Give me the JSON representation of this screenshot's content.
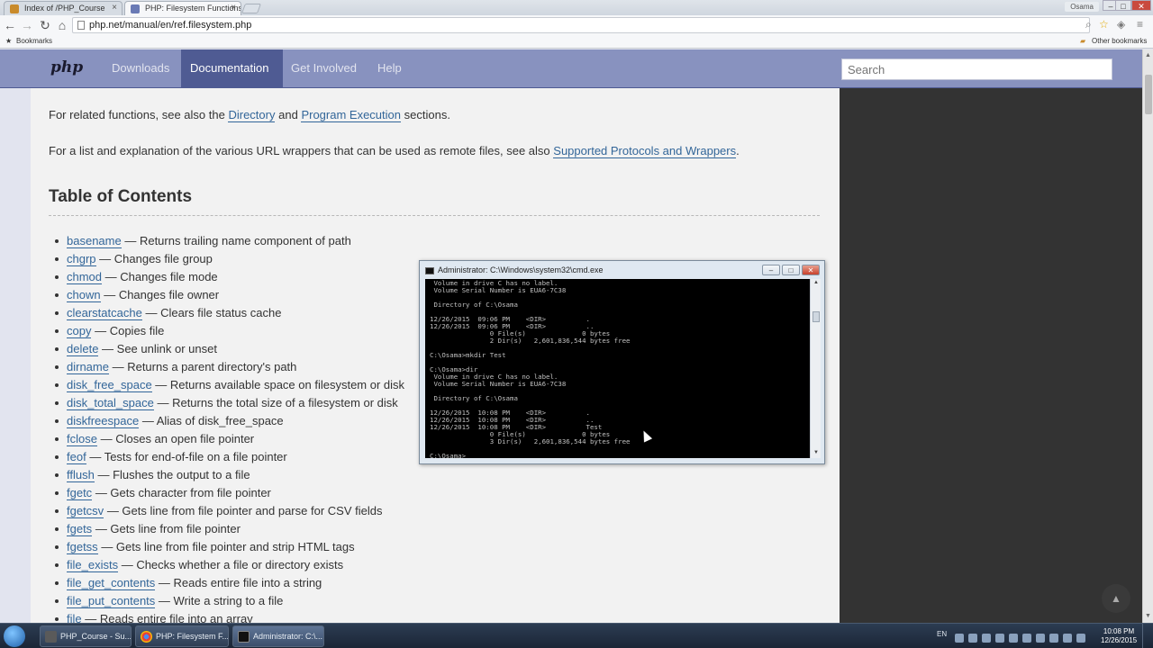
{
  "browser": {
    "tabs": [
      {
        "label": "Index of /PHP_Course",
        "active": false
      },
      {
        "label": "PHP: Filesystem Functions",
        "active": true
      }
    ],
    "user": "Osama",
    "url": "php.net/manual/en/ref.filesystem.php",
    "bookmarks_label": "Bookmarks",
    "other_bookmarks_label": "Other bookmarks"
  },
  "phpnav": {
    "logo": "php",
    "links": [
      "Downloads",
      "Documentation",
      "Get Involved",
      "Help"
    ],
    "active_link": "Documentation",
    "search_placeholder": "Search"
  },
  "content": {
    "related_prefix": "For related functions, see also the",
    "related_link1": "Directory",
    "related_and": "and",
    "related_link2": "Program Execution",
    "related_suffix": "sections.",
    "wrappers_prefix": "For a list and explanation of the various URL wrappers that can be used as remote files, see also",
    "wrappers_link": "Supported Protocols and Wrappers",
    "wrappers_suffix": ".",
    "toc_title": "Table of Contents",
    "toc": [
      {
        "fn": "basename",
        "desc": "— Returns trailing name component of path"
      },
      {
        "fn": "chgrp",
        "desc": "— Changes file group"
      },
      {
        "fn": "chmod",
        "desc": "— Changes file mode"
      },
      {
        "fn": "chown",
        "desc": "— Changes file owner"
      },
      {
        "fn": "clearstatcache",
        "desc": "— Clears file status cache"
      },
      {
        "fn": "copy",
        "desc": "— Copies file"
      },
      {
        "fn": "delete",
        "desc": "— See unlink or unset"
      },
      {
        "fn": "dirname",
        "desc": "— Returns a parent directory's path"
      },
      {
        "fn": "disk_free_space",
        "desc": "— Returns available space on filesystem or disk"
      },
      {
        "fn": "disk_total_space",
        "desc": "— Returns the total size of a filesystem or disk"
      },
      {
        "fn": "diskfreespace",
        "desc": "— Alias of disk_free_space"
      },
      {
        "fn": "fclose",
        "desc": "— Closes an open file pointer"
      },
      {
        "fn": "feof",
        "desc": "— Tests for end-of-file on a file pointer"
      },
      {
        "fn": "fflush",
        "desc": "— Flushes the output to a file"
      },
      {
        "fn": "fgetc",
        "desc": "— Gets character from file pointer"
      },
      {
        "fn": "fgetcsv",
        "desc": "— Gets line from file pointer and parse for CSV fields"
      },
      {
        "fn": "fgets",
        "desc": "— Gets line from file pointer"
      },
      {
        "fn": "fgetss",
        "desc": "— Gets line from file pointer and strip HTML tags"
      },
      {
        "fn": "file_exists",
        "desc": "— Checks whether a file or directory exists"
      },
      {
        "fn": "file_get_contents",
        "desc": "— Reads entire file into a string"
      },
      {
        "fn": "file_put_contents",
        "desc": "— Write a string to a file"
      },
      {
        "fn": "file",
        "desc": "— Reads entire file into an array"
      }
    ]
  },
  "cmd": {
    "title": "Administrator: C:\\Windows\\system32\\cmd.exe",
    "lines": [
      " Volume in drive C has no label.",
      " Volume Serial Number is EUA6-7C38",
      "",
      " Directory of C:\\Osama",
      "",
      "12/26/2015  09:06 PM    <DIR>          .",
      "12/26/2015  09:06 PM    <DIR>          ..",
      "               0 File(s)              0 bytes",
      "               2 Dir(s)   2,601,836,544 bytes free",
      "",
      "C:\\Osama>mkdir Test",
      "",
      "C:\\Osama>dir",
      " Volume in drive C has no label.",
      " Volume Serial Number is EUA6-7C38",
      "",
      " Directory of C:\\Osama",
      "",
      "12/26/2015  10:08 PM    <DIR>          .",
      "12/26/2015  10:08 PM    <DIR>          ..",
      "12/26/2015  10:08 PM    <DIR>          Test",
      "               0 File(s)              0 bytes",
      "               3 Dir(s)   2,601,836,544 bytes free",
      "",
      "C:\\Osama>_"
    ]
  },
  "taskbar": {
    "tasks": [
      {
        "label": "PHP_Course - Su...",
        "active": false
      },
      {
        "label": "PHP: Filesystem F...",
        "active": false
      },
      {
        "label": "Administrator: C:\\...",
        "active": true
      }
    ],
    "lang": "EN",
    "time": "10:08 PM",
    "date": "12/26/2015"
  },
  "colors": {
    "php_nav": "#8892bf",
    "php_nav_active": "#4f5b93",
    "link": "#336699",
    "sidebar": "#333333"
  }
}
